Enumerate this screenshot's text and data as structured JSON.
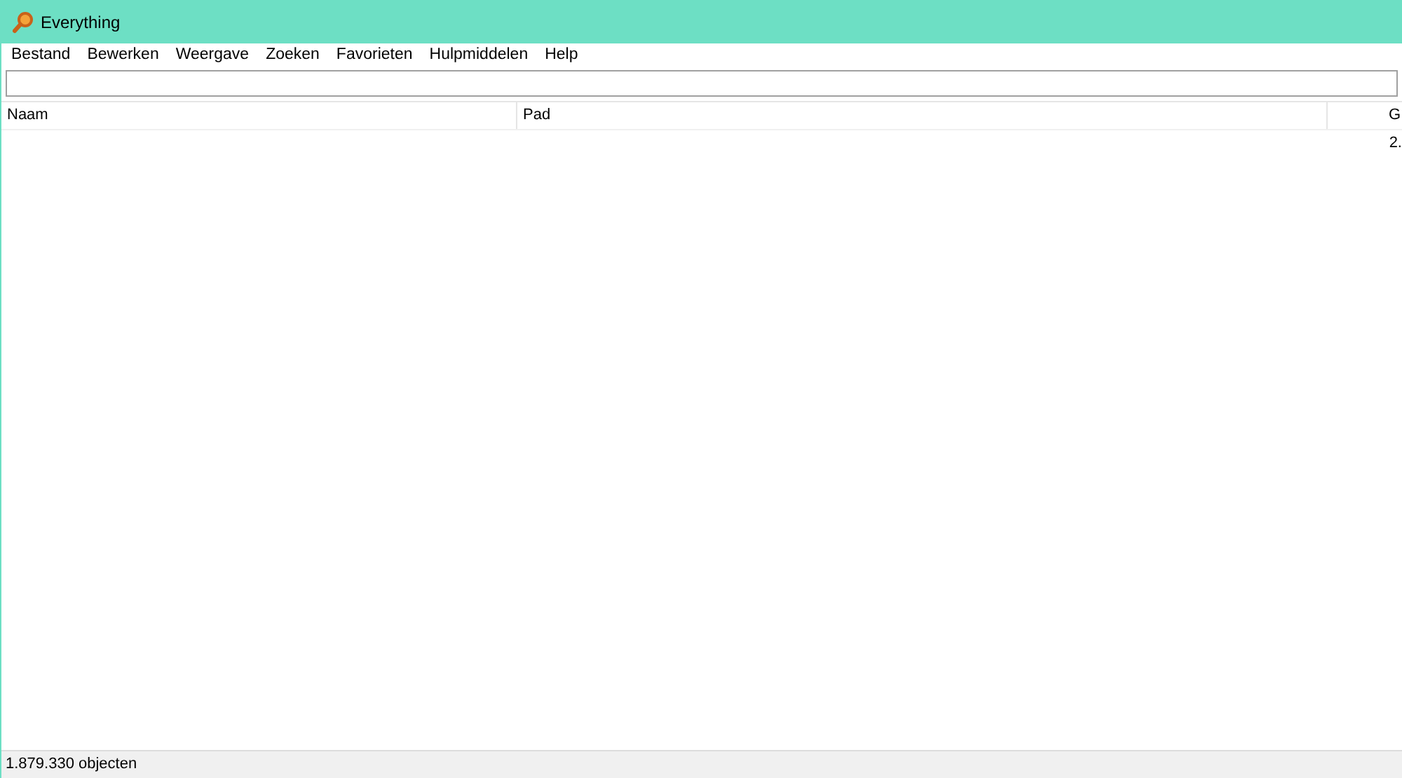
{
  "window": {
    "title": "Everything"
  },
  "menu": [
    "Bestand",
    "Bewerken",
    "Weergave",
    "Zoeken",
    "Favorieten",
    "Hulpmiddelen",
    "Help"
  ],
  "table": {
    "columns": [
      "Naam",
      "Pad",
      "G"
    ],
    "rows": [
      [
        null,
        null,
        "2."
      ]
    ]
  },
  "status_bar": "1.879.330 objecten"
}
